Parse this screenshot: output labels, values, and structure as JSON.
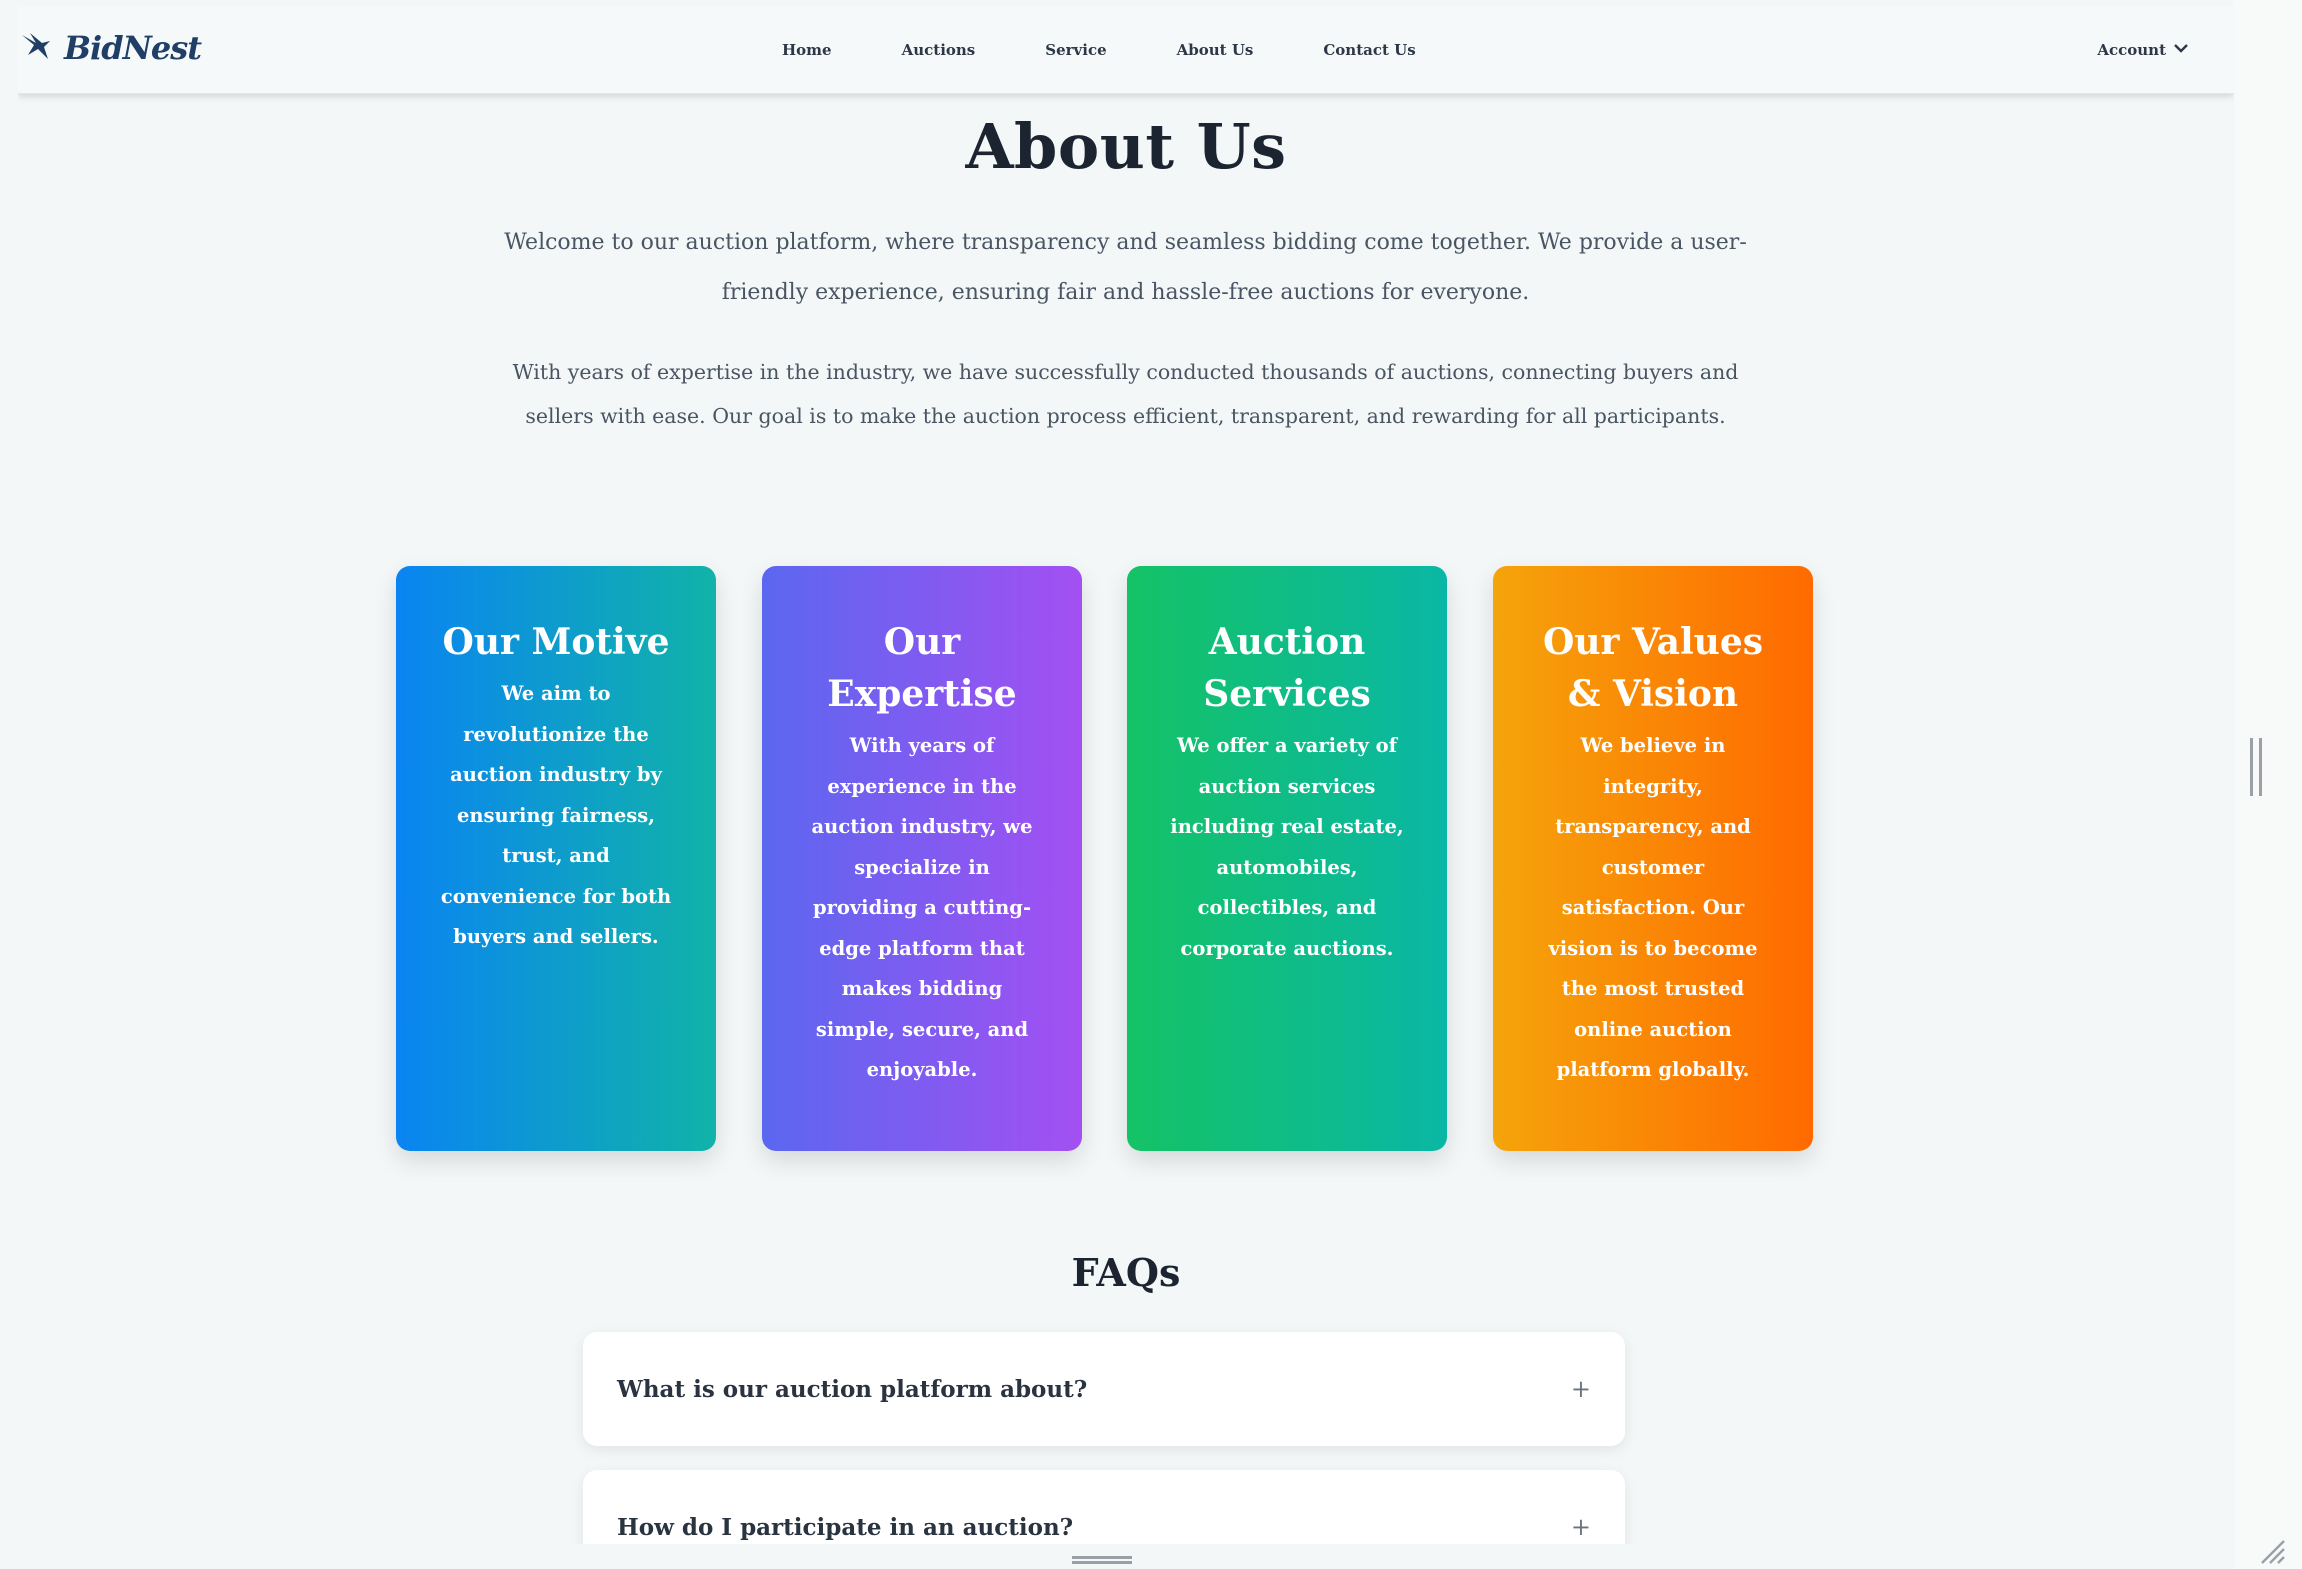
{
  "brand": {
    "name": "BidNest",
    "icon": "hawk-logo-icon"
  },
  "nav": {
    "links": [
      "Home",
      "Auctions",
      "Service",
      "About Us",
      "Contact Us"
    ],
    "account_label": "Account",
    "account_icon": "chevron-down-icon"
  },
  "about": {
    "title": "About Us",
    "intro_1": "Welcome to our auction platform, where transparency and seamless bidding come together. We provide a user-friendly experience, ensuring fair and hassle-free auctions for everyone.",
    "intro_2": "With years of expertise in the industry, we have successfully conducted thousands of auctions, connecting buyers and sellers with ease. Our goal is to make the auction process efficient, transparent, and rewarding for all participants."
  },
  "cards": [
    {
      "title": "Our Motive",
      "text": "We aim to revolutionize the auction industry by ensuring fairness, trust, and convenience for both buyers and sellers."
    },
    {
      "title": "Our Expertise",
      "text": "With years of experience in the auction industry, we specialize in providing a cutting-edge platform that makes bidding simple, secure, and enjoyable."
    },
    {
      "title": "Auction Services",
      "text": "We offer a variety of auction services including real estate, automobiles, collectibles, and corporate auctions."
    },
    {
      "title": "Our Values & Vision",
      "text": "We believe in integrity, transparency, and customer satisfaction. Our vision is to become the most trusted online auction platform globally."
    }
  ],
  "faq": {
    "title": "FAQs",
    "items": [
      {
        "question": "What is our auction platform about?",
        "toggle": "+"
      },
      {
        "question": "How do I participate in an auction?",
        "toggle": "+"
      }
    ]
  },
  "colors": {
    "card_1": [
      "#0a84f2",
      "#11b3a8"
    ],
    "card_2": [
      "#5b67f0",
      "#a350f2"
    ],
    "card_3": [
      "#14c266",
      "#0ab7a5"
    ],
    "card_4": [
      "#f5a40b",
      "#ff6a00"
    ],
    "brand": "#1f3f66"
  }
}
